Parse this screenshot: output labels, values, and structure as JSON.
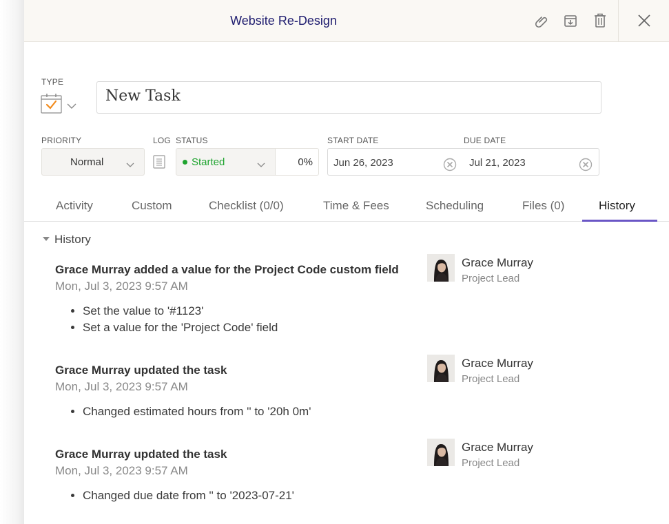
{
  "header": {
    "title": "Website Re-Design",
    "icons": [
      "paperclip-icon",
      "archive-icon",
      "trash-icon",
      "close-icon"
    ]
  },
  "type": {
    "label": "TYPE",
    "icon": "task-calendar-icon"
  },
  "task": {
    "name": "New Task"
  },
  "priority": {
    "label": "PRIORITY",
    "value": "Normal"
  },
  "log": {
    "label": "LOG"
  },
  "status": {
    "label": "STATUS",
    "value": "Started",
    "percent": "0%",
    "color": "#1fa42f"
  },
  "start_date": {
    "label": "START DATE",
    "value": "Jun 26, 2023"
  },
  "due_date": {
    "label": "DUE DATE",
    "value": "Jul 21, 2023"
  },
  "tabs": [
    {
      "label": "Activity"
    },
    {
      "label": "Custom"
    },
    {
      "label": "Checklist (0/0)"
    },
    {
      "label": "Time & Fees"
    },
    {
      "label": "Scheduling"
    },
    {
      "label": "Files (0)"
    },
    {
      "label": "History",
      "active": true
    }
  ],
  "history": {
    "title": "History",
    "entries": [
      {
        "title": "Grace Murray added a value for the Project Code custom field",
        "date": "Mon, Jul 3, 2023 9:57 AM",
        "details": [
          "Set the value to '#1123'",
          "Set a value for the 'Project Code' field"
        ],
        "user": "Grace Murray",
        "role": "Project Lead"
      },
      {
        "title": "Grace Murray updated the task",
        "date": "Mon, Jul 3, 2023 9:57 AM",
        "details": [
          "Changed estimated hours from '' to '20h 0m'"
        ],
        "user": "Grace Murray",
        "role": "Project Lead"
      },
      {
        "title": "Grace Murray updated the task",
        "date": "Mon, Jul 3, 2023 9:57 AM",
        "details": [
          "Changed due date from '' to '2023-07-21'"
        ],
        "user": "Grace Murray",
        "role": "Project Lead"
      }
    ]
  },
  "colors": {
    "accent": "#6a56c6",
    "title": "#1d1b6e",
    "status_green": "#1fa42f"
  }
}
